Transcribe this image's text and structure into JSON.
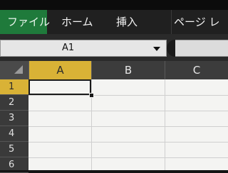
{
  "ribbon": {
    "tabs": [
      {
        "label": "ファイル"
      },
      {
        "label": "ホーム"
      },
      {
        "label": "挿入"
      },
      {
        "label": "ページ レ"
      }
    ]
  },
  "formula_bar": {
    "name_box_value": "A1"
  },
  "sheet": {
    "columns": [
      "A",
      "B",
      "C"
    ],
    "rows": [
      "1",
      "2",
      "3",
      "4",
      "5",
      "6"
    ],
    "active_cell": "A1"
  },
  "colors": {
    "file_tab": "#1f7a3b",
    "active_header": "#d9b236",
    "grid_bg": "#f4f4f2"
  }
}
